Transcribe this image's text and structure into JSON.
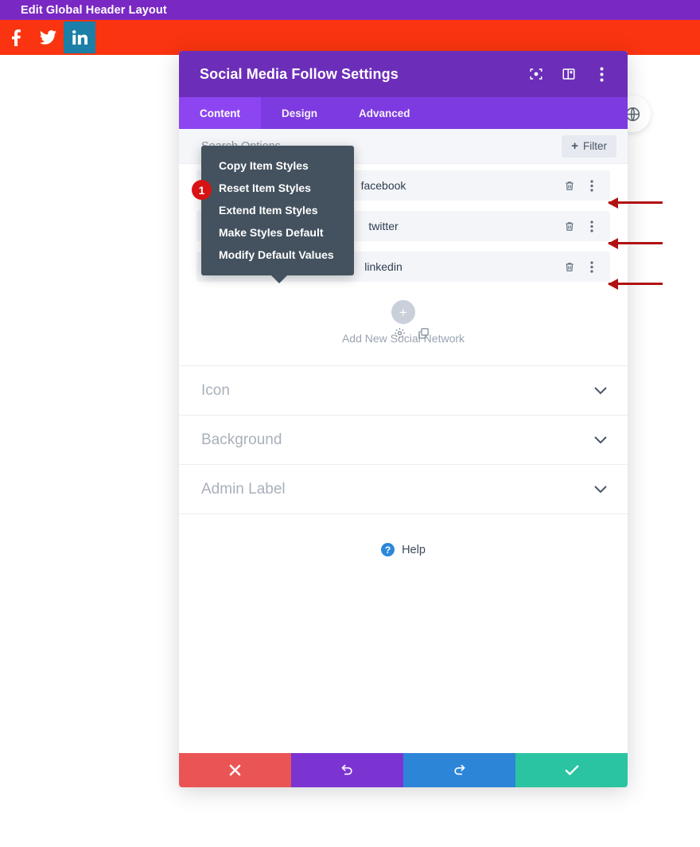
{
  "admin_bar": {
    "title": "Edit Global Header Layout"
  },
  "site_header": {
    "social_links": [
      {
        "name": "facebook",
        "icon": "facebook-icon"
      },
      {
        "name": "twitter",
        "icon": "twitter-icon"
      },
      {
        "name": "linkedin",
        "icon": "linkedin-icon"
      }
    ]
  },
  "modal": {
    "title": "Social Media Follow Settings",
    "titlebar_icons": [
      {
        "name": "focus-icon",
        "label": "Focus"
      },
      {
        "name": "layout-panel-icon",
        "label": "Layout"
      },
      {
        "name": "more-vertical-icon",
        "label": "More"
      }
    ],
    "tabs": [
      {
        "label": "Content",
        "active": true
      },
      {
        "label": "Design",
        "active": false
      },
      {
        "label": "Advanced",
        "active": false
      }
    ],
    "search_options": {
      "label": "Search Options",
      "filter_label": "Filter",
      "filter_plus": "+"
    },
    "social_list": [
      {
        "name": "facebook"
      },
      {
        "name": "twitter"
      },
      {
        "name": "linkedin"
      }
    ],
    "add_new": {
      "plus": "+",
      "label": "Add New Social Network"
    },
    "accordion": [
      {
        "label": "Icon"
      },
      {
        "label": "Background"
      },
      {
        "label": "Admin Label"
      }
    ],
    "help": {
      "mark": "?",
      "label": "Help"
    },
    "footer_buttons": [
      {
        "name": "cancel-button",
        "icon": "close-icon",
        "color": "#ea5455"
      },
      {
        "name": "undo-button",
        "icon": "undo-icon",
        "color": "#7b34d1"
      },
      {
        "name": "redo-button",
        "icon": "redo-icon",
        "color": "#2d85d8"
      },
      {
        "name": "save-button",
        "icon": "check-icon",
        "color": "#2bc4a2"
      }
    ]
  },
  "dropdown": {
    "badge": "1",
    "items": [
      {
        "label": "Copy Item Styles"
      },
      {
        "label": "Reset Item Styles"
      },
      {
        "label": "Extend Item Styles"
      },
      {
        "label": "Make Styles Default"
      },
      {
        "label": "Modify Default Values"
      }
    ]
  },
  "colors": {
    "admin_bar": "#7a28c4",
    "site_header": "#fa3410",
    "modal_titlebar": "#6c2eb9",
    "modal_tabs": "#7d3ae0",
    "modal_tab_active": "#8c45f0",
    "dropdown_bg": "#44525f",
    "badge": "#d81313",
    "annotation_arrow": "#b11212",
    "linkedin_tile": "#1b7fa8"
  }
}
